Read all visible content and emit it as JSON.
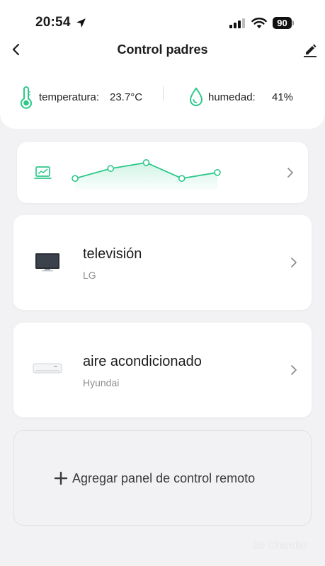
{
  "status_bar": {
    "time": "20:54",
    "battery": "90",
    "location_icon": "location-arrow-icon",
    "signal_icon": "cellular-signal-icon",
    "wifi_icon": "wifi-icon"
  },
  "nav": {
    "title": "Control padres",
    "back_icon": "chevron-left-icon",
    "edit_icon": "pencil-icon"
  },
  "environment": {
    "temperature_label": "temperatura:",
    "temperature_value": "23.7°C",
    "humidity_label": "humedad:",
    "humidity_value": "41%",
    "temperature_icon": "thermometer-icon",
    "humidity_icon": "water-drop-icon"
  },
  "chart_card": {
    "icon": "monitor-chart-icon",
    "chart_data": {
      "type": "line",
      "values": [
        3,
        5.5,
        7,
        3,
        4.5
      ],
      "ylim": [
        0,
        10
      ],
      "grid": false,
      "color": "#2ec88a"
    }
  },
  "devices": [
    {
      "name": "televisión",
      "brand": "LG",
      "icon": "tv-icon"
    },
    {
      "name": "aire acondicionado",
      "brand": "Hyundai",
      "icon": "air-conditioner-icon"
    }
  ],
  "add_panel": {
    "label": "Agregar panel de control remoto",
    "icon": "plus-icon"
  },
  "watermark": "Sir Chandler",
  "colors": {
    "accent": "#2ec88a",
    "background": "#f2f2f4",
    "card": "#ffffff",
    "secondary_text": "#8e8e93"
  }
}
